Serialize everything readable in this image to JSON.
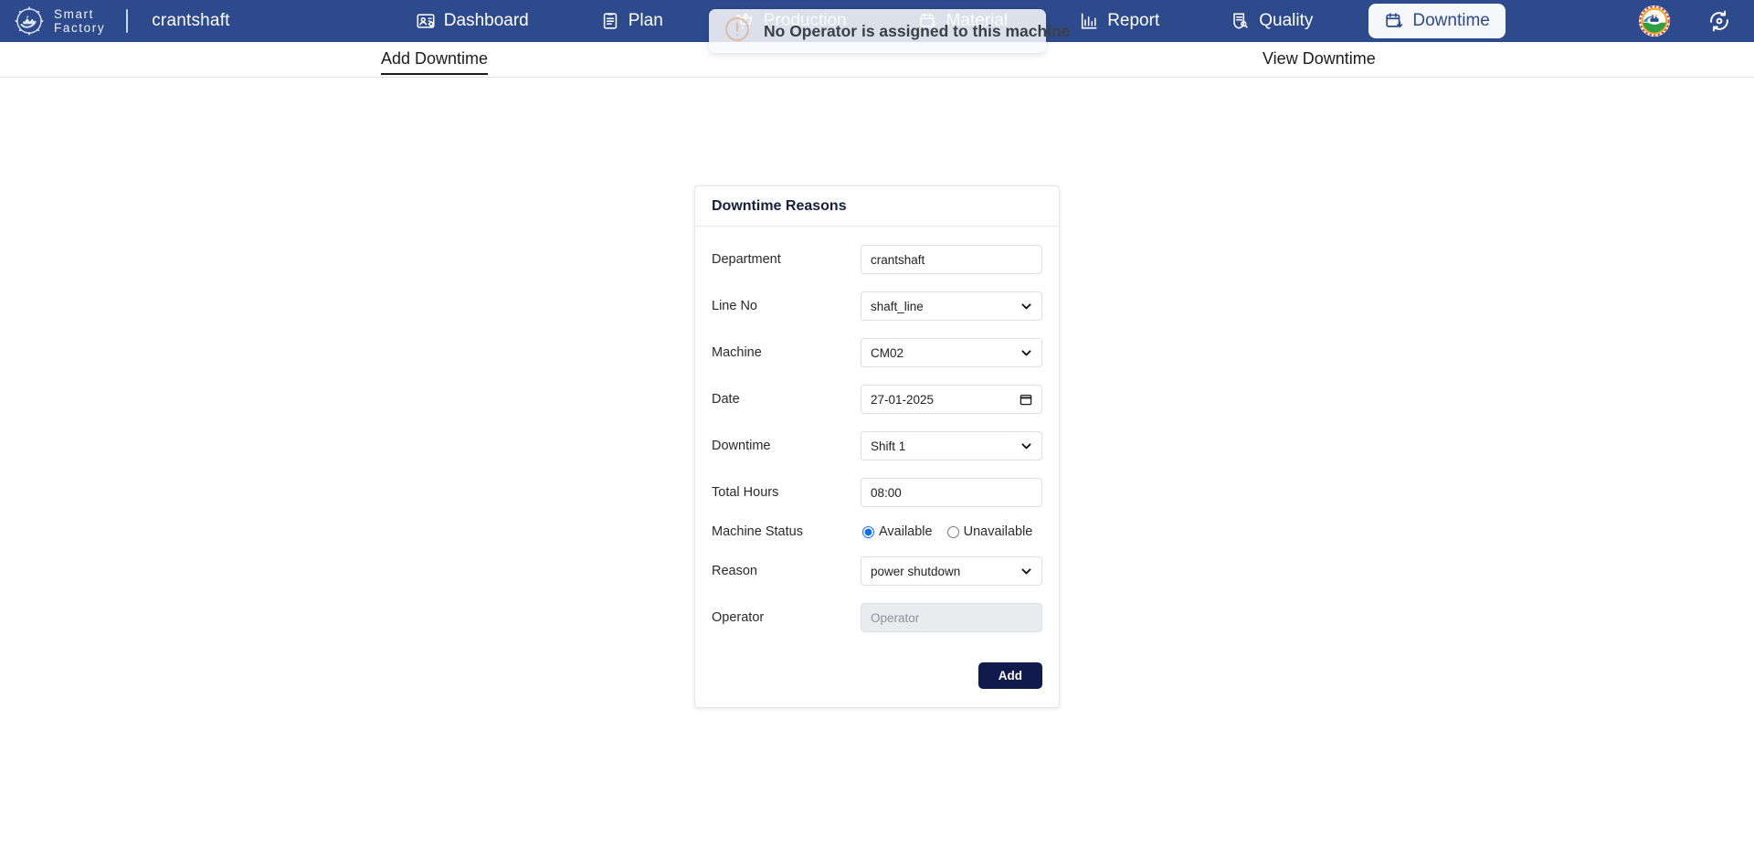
{
  "navbar": {
    "brand_line1": "Smart",
    "brand_line2": "Factory",
    "department": "crantshaft",
    "logo_icon": "smart-factory-gear-logo",
    "avatar_icon": "user-avatar-logo",
    "refresh_icon": "refresh-sync-icon",
    "items": [
      {
        "label": "Dashboard",
        "icon": "dashboard-card-icon",
        "active": false
      },
      {
        "label": "Plan",
        "icon": "clipboard-list-icon",
        "active": false
      },
      {
        "label": "Production",
        "icon": "shopping-cart-up-icon",
        "active": false
      },
      {
        "label": "Material",
        "icon": "calendar-material-icon",
        "active": false
      },
      {
        "label": "Report",
        "icon": "bar-chart-report-icon",
        "active": false
      },
      {
        "label": "Quality",
        "icon": "document-search-icon",
        "active": false
      },
      {
        "label": "Downtime",
        "icon": "calendar-download-icon",
        "active": true
      }
    ]
  },
  "toast": {
    "message": "No Operator is assigned to this machine",
    "icon": "warning-exclamation-circle-icon",
    "accent": "#e3a882"
  },
  "tabs": [
    {
      "label": "Add Downtime",
      "active": true
    },
    {
      "label": "View Downtime",
      "active": false
    }
  ],
  "card": {
    "title": "Downtime Reasons",
    "fields": {
      "department": {
        "label": "Department",
        "value": "crantshaft",
        "placeholder": "Department"
      },
      "line_no": {
        "label": "Line No",
        "value": "shaft_line",
        "options": [
          "shaft_line"
        ]
      },
      "machine": {
        "label": "Machine",
        "value": "CM02",
        "options": [
          "CM02"
        ]
      },
      "date": {
        "label": "Date",
        "value": "27-01-2025"
      },
      "downtime": {
        "label": "Downtime",
        "value": "Shift 1",
        "options": [
          "Shift 1"
        ]
      },
      "total_hours": {
        "label": "Total Hours",
        "value": "08:00",
        "placeholder": "Total Hours"
      },
      "machine_status": {
        "label": "Machine Status",
        "selected": "Available",
        "options": [
          {
            "label": "Available",
            "checked": true
          },
          {
            "label": "Unavailable",
            "checked": false
          }
        ]
      },
      "reason": {
        "label": "Reason",
        "value": "power shutdown",
        "options": [
          "power shutdown"
        ]
      },
      "operator": {
        "label": "Operator",
        "value": "",
        "placeholder": "Operator",
        "disabled": true
      }
    },
    "submit_label": "Add"
  },
  "colors": {
    "navbar_bg": "#2c4a8c",
    "active_pill_bg": "#f5f7fb",
    "submit_bg": "#101a4d",
    "radio_accent": "#0d6efd"
  }
}
